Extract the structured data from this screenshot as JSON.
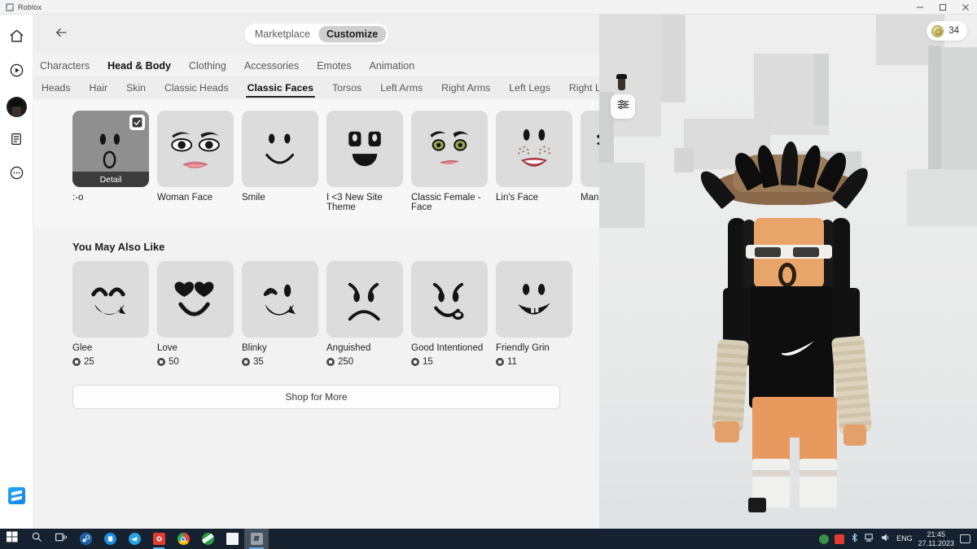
{
  "window": {
    "title": "Roblox",
    "controls": {
      "minimize": "minimize-button",
      "maximize": "maximize-button",
      "close": "close-button"
    }
  },
  "rail": {
    "items": [
      {
        "name": "home",
        "icon": "home-icon"
      },
      {
        "name": "play",
        "icon": "play-circle-icon"
      },
      {
        "name": "avatar",
        "icon": "avatar-icon"
      },
      {
        "name": "feed",
        "icon": "document-icon"
      },
      {
        "name": "more",
        "icon": "ellipsis-circle-icon"
      }
    ],
    "bottom": {
      "name": "store",
      "icon": "blue-app-icon"
    }
  },
  "header": {
    "back": "back-arrow-icon",
    "segments": [
      {
        "label": "Marketplace",
        "active": false
      },
      {
        "label": "Customize",
        "active": true
      }
    ]
  },
  "category_tabs": [
    {
      "label": "Characters",
      "active": false
    },
    {
      "label": "Head & Body",
      "active": true
    },
    {
      "label": "Clothing",
      "active": false
    },
    {
      "label": "Accessories",
      "active": false
    },
    {
      "label": "Emotes",
      "active": false
    },
    {
      "label": "Animation",
      "active": false
    }
  ],
  "sub_tabs": [
    {
      "label": "Heads",
      "active": false
    },
    {
      "label": "Hair",
      "active": false
    },
    {
      "label": "Skin",
      "active": false
    },
    {
      "label": "Classic Heads",
      "active": false
    },
    {
      "label": "Classic Faces",
      "active": true
    },
    {
      "label": "Torsos",
      "active": false
    },
    {
      "label": "Left Arms",
      "active": false
    },
    {
      "label": "Right Arms",
      "active": false
    },
    {
      "label": "Left Legs",
      "active": false
    },
    {
      "label": "Right L",
      "active": false
    }
  ],
  "owned_items": [
    {
      "label": ":-o",
      "face": "surprised",
      "selected": true,
      "detail_label": "Detail"
    },
    {
      "label": "Woman Face",
      "face": "woman",
      "selected": false
    },
    {
      "label": "Smile",
      "face": "smile",
      "selected": false
    },
    {
      "label": "I <3 New Site Theme",
      "face": "newsite",
      "selected": false
    },
    {
      "label": "Classic Female - Face",
      "face": "classicfemale",
      "selected": false
    },
    {
      "label": "Lin's Face",
      "face": "lins",
      "selected": false
    },
    {
      "label": "Man Face",
      "face": "man",
      "selected": false
    }
  ],
  "recommendations": {
    "title": "You May Also Like",
    "items": [
      {
        "label": "Glee",
        "price": "25",
        "face": "glee"
      },
      {
        "label": "Love",
        "price": "50",
        "face": "love"
      },
      {
        "label": "Blinky",
        "price": "35",
        "face": "blinky"
      },
      {
        "label": "Anguished",
        "price": "250",
        "face": "anguished"
      },
      {
        "label": "Good Intentioned",
        "price": "15",
        "face": "good"
      },
      {
        "label": "Friendly Grin",
        "price": "11",
        "face": "grin"
      }
    ]
  },
  "shop_more_label": "Shop for More",
  "viewport": {
    "robux_balance": "34",
    "settings_icon": "sliders-icon",
    "coin_icon": "robux-coin-icon"
  },
  "taskbar": {
    "start": "windows-start-icon",
    "search": "search-icon",
    "task_view": "task-view-icon",
    "apps": [
      "steam-icon",
      "blue-app-icon",
      "telegram-icon",
      "red-app-icon",
      "chrome-icon",
      "green-app-icon",
      "notepad-icon",
      "roblox-icon"
    ],
    "tray": {
      "language": "ENG",
      "time": "21:45",
      "date": "27.11.2023",
      "notification_icon": "notification-icon"
    }
  },
  "colors": {
    "accent": "#5fa8e8",
    "panel_bg": "#f2f2f2",
    "card_bg": "#f7f7f7",
    "tile_bg": "#dcdcdc",
    "selected_tile_bg": "#8f8f8f",
    "taskbar_bg": "#15212e",
    "skin": "#e8a56a",
    "hat": "#8a6a4a"
  }
}
